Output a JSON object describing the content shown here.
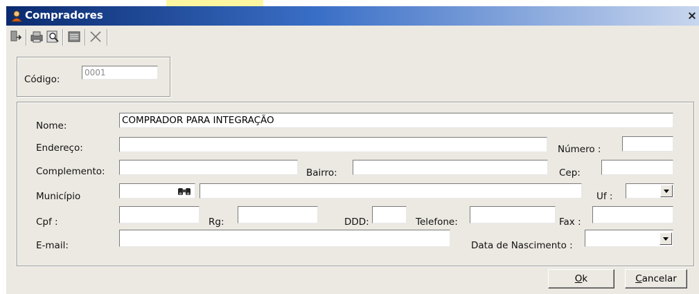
{
  "window": {
    "title": "Compradores",
    "close_glyph": "×"
  },
  "toolbar": {
    "icons": [
      "exit-icon",
      "print-icon",
      "preview-icon",
      "list-icon",
      "delete-icon"
    ]
  },
  "codigo": {
    "label": "Código:",
    "value": "0001"
  },
  "form": {
    "nome_label": "Nome:",
    "nome_value": "COMPRADOR PARA INTEGRAÇÃO",
    "endereco_label": "Endereço:",
    "endereco_value": "",
    "numero_label": "Número :",
    "numero_value": "",
    "complemento_label": "Complemento:",
    "complemento_value": "",
    "bairro_label": "Bairro:",
    "bairro_value": "",
    "cep_label": "Cep:",
    "cep_value": "",
    "municipio_label": "Município",
    "municipio_code": "",
    "municipio_name": "",
    "uf_label": "Uf :",
    "uf_value": "",
    "cpf_label": "Cpf :",
    "cpf_value": "",
    "rg_label": "Rg:",
    "rg_value": "",
    "ddd_label": "DDD:",
    "ddd_value": "",
    "telefone_label": "Telefone:",
    "telefone_value": "",
    "fax_label": "Fax :",
    "fax_value": "",
    "email_label": "E-mail:",
    "email_value": "",
    "nascimento_label": "Data de Nascimento :",
    "nascimento_value": ""
  },
  "buttons": {
    "ok_mnemonic": "O",
    "ok_rest": "k",
    "cancel_mnemonic": "C",
    "cancel_rest": "ancelar"
  }
}
